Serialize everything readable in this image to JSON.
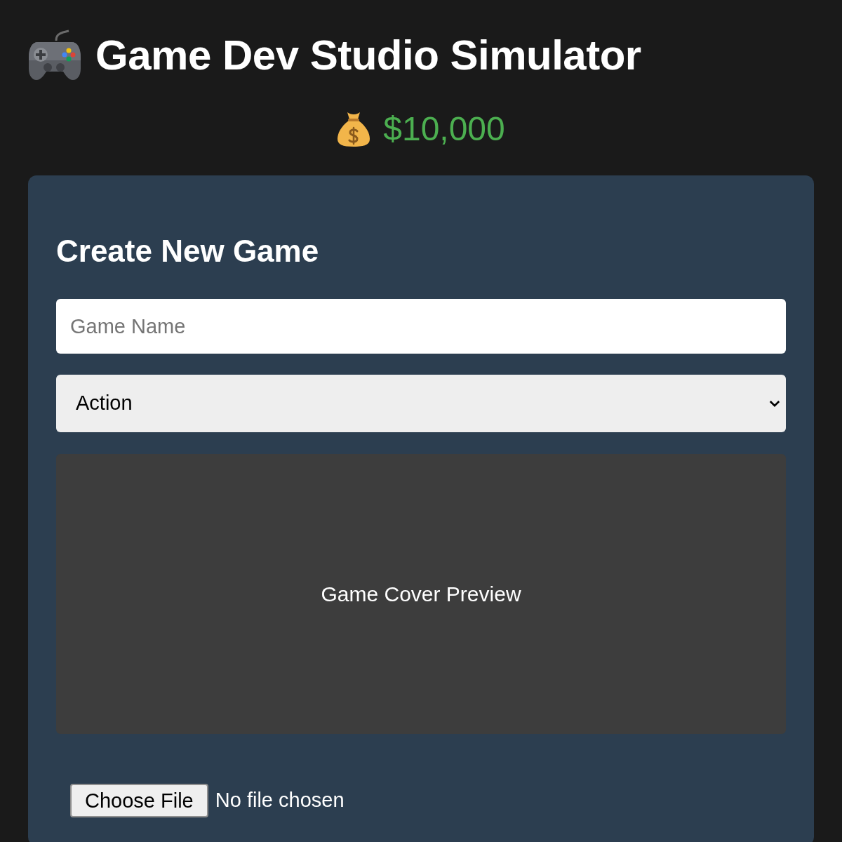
{
  "header": {
    "title": "Game Dev Studio Simulator",
    "money": "$10,000"
  },
  "create_game": {
    "title": "Create New Game",
    "name_field": {
      "placeholder": "Game Name"
    },
    "genre_select": {
      "value": "Action"
    },
    "cover_preview": {
      "label": "Game Cover Preview"
    },
    "file_input": {
      "button": "Choose File",
      "status": "No file chosen"
    }
  }
}
